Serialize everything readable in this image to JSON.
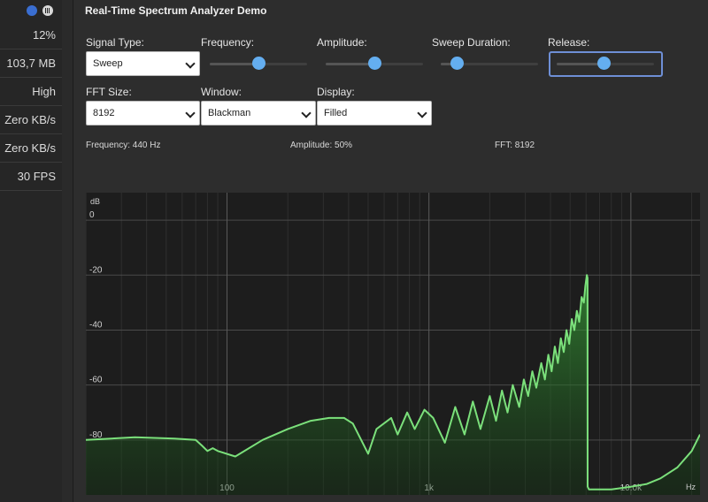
{
  "sidebar": {
    "stats": [
      "12%",
      "103,7 MB",
      "High",
      "Zero KB/s",
      "Zero KB/s",
      "30 FPS"
    ]
  },
  "title": "Real-Time Spectrum Analyzer Demo",
  "controls": {
    "signal_type": {
      "label": "Signal Type:",
      "value": "Sweep"
    },
    "frequency": {
      "label": "Frequency:",
      "level": 0.5
    },
    "amplitude": {
      "label": "Amplitude:",
      "level": 0.5
    },
    "sweep_duration": {
      "label": "Sweep Duration:",
      "level": 0.16
    },
    "release": {
      "label": "Release:",
      "level": 0.48
    },
    "fft_size": {
      "label": "FFT Size:",
      "value": "8192"
    },
    "window": {
      "label": "Window:",
      "value": "Blackman"
    },
    "display": {
      "label": "Display:",
      "value": "Filled"
    }
  },
  "readouts": {
    "frequency": "Frequency: 440 Hz",
    "amplitude": "Amplitude: 50%",
    "fft": "FFT: 8192"
  },
  "colors": {
    "accent": "#64aef0",
    "spectrum_line": "#7be07b",
    "plot_bg": "#1d1d1d"
  },
  "chart_data": {
    "type": "area",
    "x_scale": "log",
    "xlabel": "Hz",
    "ylabel": "dB",
    "x_ticks": [
      {
        "value": 100,
        "label": "100"
      },
      {
        "value": 1000,
        "label": "1k"
      },
      {
        "value": 10000,
        "label": "10.0k"
      }
    ],
    "y_ticks": [
      {
        "value": 0,
        "label": "0"
      },
      {
        "value": -20,
        "label": "-20"
      },
      {
        "value": -40,
        "label": "-40"
      },
      {
        "value": -60,
        "label": "-60"
      },
      {
        "value": -80,
        "label": "-80"
      }
    ],
    "xlim": [
      20,
      22000
    ],
    "ylim": [
      -100,
      10
    ],
    "series": [
      {
        "x": [
          20,
          35,
          55,
          70,
          75,
          80,
          85,
          90,
          110,
          150,
          200,
          260,
          320,
          380,
          420,
          500,
          550,
          650,
          700,
          780,
          850,
          950,
          1050,
          1200,
          1350,
          1500,
          1650,
          1800,
          2000,
          2150,
          2300,
          2450,
          2600,
          2800,
          2950,
          3100,
          3250,
          3400,
          3600,
          3750,
          3900,
          4050,
          4200,
          4350,
          4500,
          4650,
          4800,
          4950,
          5100,
          5250,
          5400,
          5550,
          5700,
          5850,
          5950,
          6050,
          6100,
          6110,
          6200,
          8000,
          10000,
          12000,
          14000,
          17000,
          20000,
          22000
        ],
        "y": [
          -80,
          -79,
          -79.5,
          -80,
          -82,
          -84,
          -83,
          -84,
          -86,
          -80,
          -76,
          -73,
          -72,
          -72,
          -74,
          -85,
          -76,
          -72,
          -78,
          -70,
          -76,
          -69,
          -72,
          -81,
          -68,
          -78,
          -66,
          -76,
          -64,
          -73,
          -62,
          -70,
          -60,
          -68,
          -58,
          -64,
          -55,
          -61,
          -52,
          -58,
          -49,
          -55,
          -46,
          -52,
          -43,
          -48,
          -40,
          -45,
          -36,
          -40,
          -33,
          -37,
          -28,
          -30,
          -24,
          -20,
          -21,
          -97,
          -98,
          -98,
          -97,
          -96,
          -94,
          -90,
          -84,
          -78
        ]
      }
    ]
  }
}
